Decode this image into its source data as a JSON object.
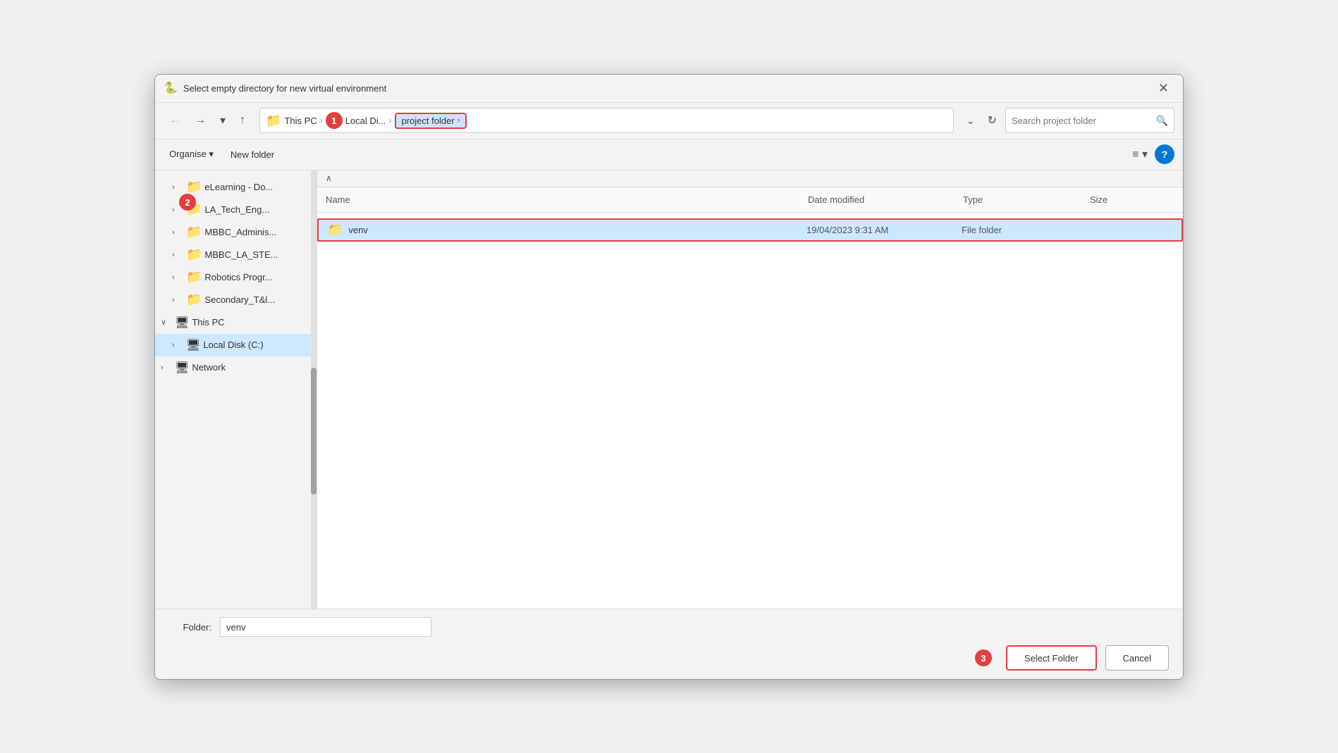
{
  "titlebar": {
    "icon": "🐍",
    "title": "Select empty directory for new virtual environment",
    "close_label": "✕"
  },
  "navbar": {
    "back_label": "←",
    "forward_label": "→",
    "dropdown_label": "▾",
    "up_label": "↑",
    "breadcrumb": {
      "folder_icon": "📁",
      "items": [
        {
          "label": "This PC"
        },
        {
          "label": "Local Di..."
        },
        {
          "label": "project folder"
        }
      ]
    },
    "dropdown_arrow": "⌄",
    "refresh_label": "↻",
    "search_placeholder": "Search project folder",
    "search_icon": "🔍",
    "badge1": "1"
  },
  "toolbar": {
    "organise_label": "Organise",
    "organise_arrow": "▾",
    "new_folder_label": "New folder",
    "view_icon": "≡",
    "view_arrow": "▾",
    "help_label": "?"
  },
  "sidebar": {
    "items": [
      {
        "id": "elearning",
        "indent": 1,
        "expanded": false,
        "icon": "📁",
        "icon_color": "yellow",
        "label": "eLearning - Do..."
      },
      {
        "id": "la-tech-eng",
        "indent": 1,
        "expanded": false,
        "icon": "📁",
        "icon_color": "yellow",
        "label": "LA_Tech_Eng..."
      },
      {
        "id": "mbbc-admin",
        "indent": 1,
        "expanded": false,
        "icon": "📁",
        "icon_color": "yellow",
        "label": "MBBC_Adminis..."
      },
      {
        "id": "mbbc-la-stem",
        "indent": 1,
        "expanded": false,
        "icon": "📁",
        "icon_color": "yellow",
        "label": "MBBC_LA_STE..."
      },
      {
        "id": "robotics",
        "indent": 1,
        "expanded": false,
        "icon": "📁",
        "icon_color": "yellow",
        "label": "Robotics Progr..."
      },
      {
        "id": "secondary",
        "indent": 1,
        "expanded": false,
        "icon": "📁",
        "icon_color": "yellow",
        "label": "Secondary_T&l..."
      },
      {
        "id": "this-pc",
        "indent": 0,
        "expanded": true,
        "icon": "💻",
        "icon_color": "blue",
        "label": "This PC"
      },
      {
        "id": "local-disk",
        "indent": 1,
        "expanded": true,
        "icon": "💾",
        "icon_color": "blue",
        "label": "Local Disk (C:)",
        "active": true
      },
      {
        "id": "network",
        "indent": 0,
        "expanded": false,
        "icon": "🖥",
        "icon_color": "blue",
        "label": "Network"
      }
    ]
  },
  "file_list": {
    "sort_arrow": "∧",
    "headers": [
      "Name",
      "Date modified",
      "Type",
      "Size"
    ],
    "rows": [
      {
        "id": "venv",
        "name": "venv",
        "icon": "📁",
        "date_modified": "19/04/2023 9:31 AM",
        "type": "File folder",
        "size": "",
        "selected": true
      }
    ]
  },
  "bottom": {
    "folder_label": "Folder:",
    "folder_value": "venv",
    "folder_placeholder": "",
    "select_folder_label": "Select Folder",
    "cancel_label": "Cancel",
    "badge3": "3"
  },
  "badges": {
    "b1": "1",
    "b2": "2",
    "b3": "3"
  }
}
